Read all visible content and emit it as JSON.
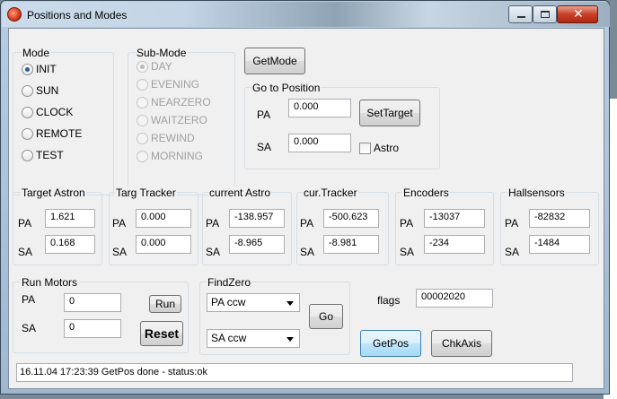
{
  "window": {
    "title": "Positions and Modes"
  },
  "mode": {
    "label": "Mode",
    "options": [
      "INIT",
      "SUN",
      "CLOCK",
      "REMOTE",
      "TEST"
    ],
    "selected": "INIT"
  },
  "submode": {
    "label": "Sub-Mode",
    "options": [
      "DAY",
      "EVENING",
      "NEARZERO",
      "WAITZERO",
      "REWIND",
      "MORNING"
    ],
    "selected": "DAY"
  },
  "getmode_button": "GetMode",
  "goto": {
    "label": "Go to Position",
    "pa_label": "PA",
    "pa_value": "0.000",
    "sa_label": "SA",
    "sa_value": "0.000",
    "settarget_button": "SetTarget",
    "astro_label": "Astro"
  },
  "panels": [
    {
      "label": "Target Astron",
      "pa_label": "PA",
      "pa": "1.621",
      "sa_label": "SA",
      "sa": "0.168"
    },
    {
      "label": "Targ Tracker",
      "pa_label": "PA",
      "pa": "0.000",
      "sa_label": "SA",
      "sa": "0.000"
    },
    {
      "label": "current Astro",
      "pa_label": "PA",
      "pa": "-138.957",
      "sa_label": "SA",
      "sa": "-8.965"
    },
    {
      "label": "cur.Tracker",
      "pa_label": "PA",
      "pa": "-500.623",
      "sa_label": "SA",
      "sa": "-8.981"
    },
    {
      "label": "Encoders",
      "pa_label": "PA",
      "pa": "-13037",
      "sa_label": "SA",
      "sa": "-234"
    },
    {
      "label": "Hallsensors",
      "pa_label": "PA",
      "pa": "-82832",
      "sa_label": "SA",
      "sa": "-1484"
    }
  ],
  "runmotors": {
    "label": "Run Motors",
    "pa_label": "PA",
    "pa_value": "0",
    "sa_label": "SA",
    "sa_value": "0",
    "run_button": "Run",
    "reset_button": "Reset"
  },
  "findzero": {
    "label": "FindZero",
    "combo1": "PA ccw",
    "combo2": "SA ccw",
    "go_button": "Go"
  },
  "flags": {
    "label": "flags",
    "value": "00002020"
  },
  "getpos_button": "GetPos",
  "chkaxis_button": "ChkAxis",
  "status": "16.11.04 17:23:39  GetPos done - status:ok"
}
